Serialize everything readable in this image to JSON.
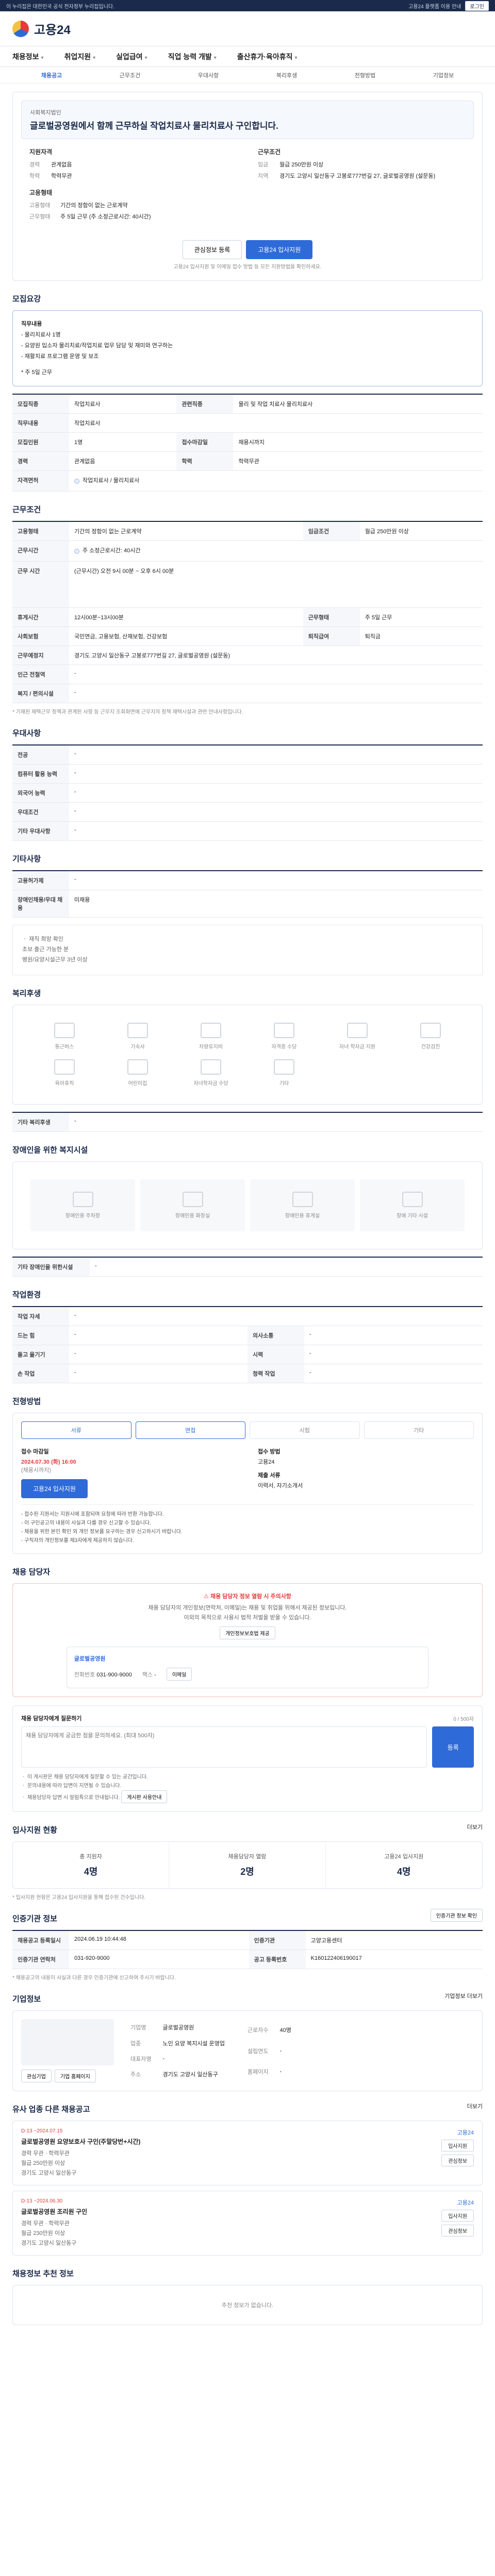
{
  "topbar": {
    "notice": "이 누리집은 대한민국 공식 전자정부 누리집입니다.",
    "links": [
      "회원",
      "기업"
    ],
    "right_text": "고용24 플랫폼 이용 안내",
    "button": "로그인"
  },
  "header": {
    "logo": "고용24"
  },
  "nav": {
    "items": [
      "채용정보",
      "취업지원",
      "실업급여",
      "직업 능력 개발",
      "출산휴가·육아휴직"
    ]
  },
  "subnav": {
    "items": [
      "채용공고",
      "근무조건",
      "우대사항",
      "복리후생",
      "전형방법",
      "기업정보"
    ]
  },
  "summary": {
    "company": "사회복지법인",
    "title": "글로벌공영원에서 함께 근무하실 작업치료사 물리치료사 구인합니다.",
    "left_heading": "지원자격",
    "left_rows": [
      {
        "k": "경력",
        "v": "관계없음"
      },
      {
        "k": "학력",
        "v": "학력무관"
      }
    ],
    "right_heading": "근무조건",
    "right_rows": [
      {
        "k": "임금",
        "v": "월급 250만원 이상"
      },
      {
        "k": "지역",
        "v": "경기도 고양시 일산동구 고봉로777번길 27, 글로벌공영원 (설문동)"
      }
    ],
    "type_heading": "고용형태",
    "type_rows": [
      {
        "k": "고용형태",
        "v": "기간의 정함이 없는 근로계약"
      },
      {
        "k": "근무형태",
        "v": "주 5일 근무 (주 소정근로시간: 40시간)"
      }
    ],
    "buttons": {
      "save": "관심정보 등록",
      "apply": "고용24 입사지원"
    },
    "note": "고용24 입사지원 및 이메일 접수 방법 등 모든 지원방법을 확인하세요."
  },
  "recruit": {
    "title": "모집요강",
    "duties_heading": "직무내용",
    "duties": [
      "- 물리치료사 1명",
      "- 요양원 입소자 물리치료/작업치료 업무 담당 및 재미와 연구하는",
      "- 재활치료 프로그램 운영 및 보조",
      "",
      "* 주 5일 근무"
    ],
    "rows": [
      {
        "k": "모집직종",
        "v": "작업치료사",
        "k2": "관련직종",
        "v2": "물리 및 작업 치료사 물리치료사"
      },
      {
        "k": "직무내용",
        "v": "작업치료사",
        "k2": "",
        "v2": ""
      },
      {
        "k": "모집인원",
        "v": "1명",
        "k2": "접수마감일",
        "v2": "채용시까지"
      },
      {
        "k": "경력",
        "v": "관계없음",
        "k2": "학력",
        "v2": "학력무관"
      },
      {
        "k": "자격면허",
        "v": "작업치료사 / 물리치료사",
        "k2": "",
        "v2": ""
      }
    ]
  },
  "conditions": {
    "title": "근무조건",
    "rows": [
      {
        "k": "고용형태",
        "v": "기간의 정함이 없는 근로계약",
        "k2": "임금조건",
        "v2": "월급 250만원 이상"
      },
      {
        "k": "근무시간",
        "v": "주 소정근로시간: 40시간",
        "k2": "",
        "v2": ""
      },
      {
        "k": "근무 시간",
        "v": "(근무시간) 오전 9시 00분 ~ 오후 6시 00분",
        "k2": "",
        "v2": ""
      },
      {
        "k": "휴게시간",
        "v": "12시00분~13시00분",
        "k2": "근무형태",
        "v2": "주 5일 근무"
      },
      {
        "k": "사회보험",
        "v": "국민연금, 고용보험, 산재보험, 건강보험",
        "k2": "퇴직급여",
        "v2": "퇴직금"
      },
      {
        "k": "근무예정지",
        "v": "경기도 고양시 일산동구 고봉로777번길 27, 글로벌공영원 (설문동)",
        "k2": "",
        "v2": ""
      },
      {
        "k": "인근 전철역",
        "v": "-",
        "k2": "",
        "v2": ""
      },
      {
        "k": "복지 / 편의시설",
        "v": "-",
        "k2": "",
        "v2": ""
      }
    ],
    "note": "* 기재된 재택근무 정책과 관계된 사항 등 근무지 조회화면에 근무지의 정책 재택시설과 관련 안내사항입니다."
  },
  "preference": {
    "title": "우대사항",
    "rows": [
      {
        "k": "전공",
        "v": "-"
      },
      {
        "k": "컴퓨터 활용 능력",
        "v": "-"
      },
      {
        "k": "외국어 능력",
        "v": "-"
      },
      {
        "k": "우대조건",
        "v": "-"
      },
      {
        "k": "기타 우대사항",
        "v": "-"
      }
    ]
  },
  "other": {
    "title": "기타사항",
    "rows": [
      {
        "k": "고용허가제",
        "v": "-"
      },
      {
        "k": "장애인채용/우대 채용",
        "v": "미채용"
      }
    ],
    "extra": [
      "ㆍ 재직 희망 확인",
      "초보 출근 가능한 분",
      "병원/요양시설근무 3년 이상"
    ]
  },
  "welfare": {
    "title": "복리후생",
    "items": [
      "통근버스",
      "기숙사",
      "차량유지비",
      "자격증 수당",
      "자녀 학자금 지원",
      "건강검진",
      "육아휴직",
      "어린이집",
      "자녀학자금 수당",
      "기타"
    ],
    "note_label": "기타 복리후생",
    "note_value": "-"
  },
  "disability": {
    "title": "장애인을 위한 복지시설",
    "items": [
      "장애인용 주차장",
      "장애인용 화장실",
      "장애인용 휴게실",
      "장애 기타 시설"
    ],
    "note_label": "기타 장애인을 위한시설",
    "note_value": "-"
  },
  "workenv": {
    "title": "작업환경",
    "rows": [
      {
        "k": "작업 자세",
        "v": "-",
        "k2": "",
        "v2": ""
      },
      {
        "k": "드는 힘",
        "v": "-",
        "k2": "의사소통",
        "v2": "-"
      },
      {
        "k": "들고 옮기기",
        "v": "-",
        "k2": "시력",
        "v2": "-"
      },
      {
        "k": "손 작업",
        "v": "-",
        "k2": "청력 작업",
        "v2": "-"
      }
    ]
  },
  "selection": {
    "title": "전형방법",
    "steps": [
      "서류",
      "면접",
      "시험",
      "기타"
    ],
    "deadline_label": "접수 마감일",
    "deadline": "2024.07.30 (화) 16:00",
    "deadline_note": "(채용시까지)",
    "apply_btn": "고용24 입사지원",
    "method_label": "접수 방법",
    "method": "고용24",
    "docs_label": "제출 서류",
    "docs": "이력서, 자기소개서",
    "bullets": [
      "- 접수된 지원서는 지원시에 포함되며 요청에 따라 반환 가능합니다.",
      "- 이 구인공고의 내용이 사실과 다를 경우 신고할 수 있습니다.",
      "- 채용을 위한 본인 확인 외 개인 정보를 요구하는 경우 신고하시기 바랍니다.",
      "- 구직자의 개인정보를 제3자에게 제공하지 않습니다."
    ]
  },
  "contact": {
    "title": "채용 담당자",
    "alert_head": "채용 담당자 정보 열람 시 주의사항",
    "alert_lines": [
      "채용 담당자의 개인정보(연락처, 이메일)는 채용 및 취업을 위해서 제공된 정보입니다.",
      "이외의 목적으로 사용시 법적 처벌을 받을 수 있습니다."
    ],
    "alert_btn": "개인정보보호법 제공",
    "card_name": "글로벌공영원",
    "card_phone_label": "전화번호",
    "card_phone": "031-900-9000",
    "card_fax_label": "팩스",
    "card_fax": "-",
    "card_btn": "이메일"
  },
  "qa": {
    "title": "채용 담당자에게 질문하기",
    "placeholder": "채용 담당자에게 궁금한 점을 문의하세요. (최대 500자)",
    "submit": "등록",
    "count": "0 / 500자",
    "notes": [
      "ㆍ 이 게시판은 채용 담당자에게 질문할 수 있는 공간입니다.",
      "ㆍ 문의내용에 따라 답변이 지연될 수 있습니다.",
      "ㆍ 채용담당자 답변 시 알림톡으로 안내됩니다."
    ],
    "notes_btn": "게시판 사용안내"
  },
  "status": {
    "title": "입사지원 현황",
    "more": "더보기",
    "cells": [
      {
        "label": "총 지원자",
        "value": "4명"
      },
      {
        "label": "채용담당자 열람",
        "value": "2명"
      },
      {
        "label": "고용24 입사지원",
        "value": "4명"
      }
    ],
    "note": "* 입사지원 현황은 고용24 입사지원을 통해 접수된 건수입니다."
  },
  "reginfo": {
    "title": "인증기관 정보",
    "btn": "인증기관 정보 확인",
    "rows": [
      {
        "k": "채용공고 등록일시",
        "v": "2024.06.19 10:44:48",
        "k2": "인증기관",
        "v2": "고양고용센터"
      },
      {
        "k": "인증기관 연락처",
        "v": "031-920-9000",
        "k2": "공고 등록번호",
        "v2": "K160122406190017"
      }
    ],
    "note": "* 채용공고의 내용이 사실과 다른 경우 인증기관에 신고하여 주시기 바랍니다."
  },
  "company": {
    "title": "기업정보",
    "more": "기업정보 더보기",
    "rows": [
      {
        "k": "기업명",
        "v": "글로벌공영원"
      },
      {
        "k": "업종",
        "v": "노인 요양 복지시설 운영업"
      },
      {
        "k": "대표자명",
        "v": "-"
      },
      {
        "k": "주소",
        "v": "경기도 고양시 일산동구"
      }
    ],
    "right_rows": [
      {
        "k": "근로자수",
        "v": "40명"
      },
      {
        "k": "설립연도",
        "v": "-"
      },
      {
        "k": "홈페이지",
        "v": "-"
      }
    ],
    "btns": [
      "관심기업",
      "기업 홈페이지"
    ]
  },
  "similar": {
    "title": "유사 업종 다른 채용공고",
    "more": "더보기",
    "items": [
      {
        "date": "D-13 ~2024.07.15",
        "title": "글로벌공영원 요양보호사 구인(주말당번+시간)",
        "meta": [
          "경력 무관 · 학력무관",
          "월급 250만원 이상",
          "경기도 고양시 일산동구"
        ],
        "side_company": "고용24",
        "buttons": [
          "입사지원",
          "관심정보"
        ]
      },
      {
        "date": "D-13 ~2024.06.30",
        "title": "글로벌공영원 조리원 구인",
        "meta": [
          "경력 무관 · 학력무관",
          "월급 230만원 이상",
          "경기도 고양시 일산동구"
        ],
        "side_company": "고용24",
        "buttons": [
          "입사지원",
          "관심정보"
        ]
      }
    ]
  },
  "recommend": {
    "title": "채용정보 추천 정보",
    "empty": "추천 정보가 없습니다."
  }
}
